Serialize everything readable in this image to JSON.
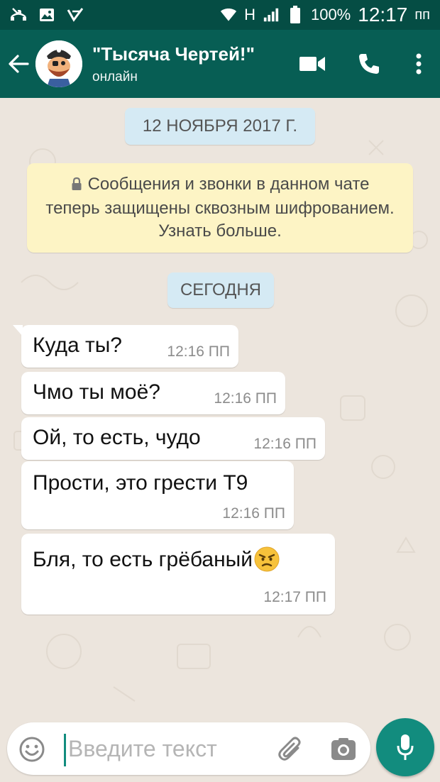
{
  "status_bar": {
    "network_type": "H",
    "battery_percent": "100%",
    "time": "12:17",
    "ampm": "пп"
  },
  "header": {
    "title": "\"Тысяча Чертей!\"",
    "status": "онлайн"
  },
  "chat": {
    "date_chip_1": "12 НОЯБРЯ 2017 Г.",
    "encryption_notice": "Сообщения и звонки в данном чате теперь защищены сквозным шифрованием. Узнать больше.",
    "date_chip_2": "СЕГОДНЯ",
    "messages": [
      {
        "text": "Куда ты?",
        "time": "12:16 ПП"
      },
      {
        "text": "Чмо ты моё?",
        "time": "12:16 ПП"
      },
      {
        "text": "Ой, то есть, чудо",
        "time": "12:16 ПП"
      },
      {
        "text": "Прости, это грести Т9",
        "time": "12:16 ПП"
      },
      {
        "text": "Бля, то есть грёбаный",
        "time": "12:17 ПП"
      }
    ]
  },
  "input": {
    "placeholder": "Введите текст"
  },
  "colors": {
    "header": "#075e54",
    "status_bar": "#054d44",
    "accent": "#128c7e",
    "chat_background": "#ece5dd",
    "notice_background": "#fdf4c5",
    "date_chip_background": "#d5eaf4"
  }
}
